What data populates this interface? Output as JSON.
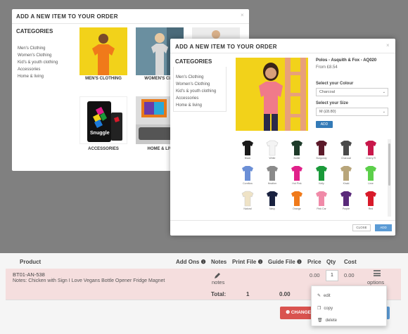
{
  "order": {
    "headers": {
      "product": "Product",
      "addons": "Add Ons ❶",
      "notes": "Notes",
      "print_file": "Print File ❶",
      "guide_file": "Guide File ❶",
      "price": "Price",
      "qty": "Qty",
      "cost": "Cost"
    },
    "row": {
      "sku": "BT01-AN-538",
      "notes_label": "Notes:",
      "notes_text": "Chicken with Sign I Love Vegans Bottle Opener Fridge Magnet",
      "notes_icon_label": "notes",
      "price": "0.00",
      "qty": "1",
      "cost": "0.00",
      "options_label": "options"
    },
    "total": {
      "label": "Total:",
      "qty": "1",
      "amount": "0.00"
    },
    "change_button": "CHANGE",
    "menu": {
      "edit": "edit",
      "copy": "copy",
      "delete": "delete"
    }
  },
  "modal1": {
    "title": "ADD A NEW ITEM TO YOUR ORDER",
    "close": "×",
    "categories_heading": "CATEGORIES",
    "categories": [
      "Men's Clothing",
      "Women's Clothing",
      "Kid's & youth clothing",
      "Accessories",
      "Home & living"
    ],
    "tiles": [
      {
        "label": "MEN'S CLOTHING"
      },
      {
        "label": "WOMEN'S CLO"
      },
      {
        "label": "ACCESSORIES"
      },
      {
        "label": "HOME & LIV"
      }
    ],
    "snuggle_text": "Snuggle"
  },
  "modal2": {
    "title": "ADD A NEW ITEM TO YOUR ORDER",
    "close": "×",
    "categories_heading": "CATEGORIES",
    "categories": [
      "Men's Clothing",
      "Women's Clothing",
      "Kid's & youth clothing",
      "Accessories",
      "Home & living"
    ],
    "product_title": "Polos - Asquith & Fox - AQ020",
    "product_price": "From £8.54",
    "colour_label": "Select your Colour",
    "colour_value": "Charcoal",
    "size_label": "Select your Size",
    "size_value": "M (£8.80)",
    "add_button": "ADD",
    "swatches": [
      {
        "name": "Black",
        "color": "#1a1a1a"
      },
      {
        "name": "White",
        "color": "#f4f4f4"
      },
      {
        "name": "Bottle",
        "color": "#1e3b2a"
      },
      {
        "name": "Burgundy",
        "color": "#5c1a2a"
      },
      {
        "name": "Charcoal",
        "color": "#4a4a4a"
      },
      {
        "name": "Cherry R",
        "color": "#c8174a"
      },
      {
        "name": "Cornflow",
        "color": "#6b8fd6"
      },
      {
        "name": "Heather",
        "color": "#8a8a8a"
      },
      {
        "name": "Hot Pink",
        "color": "#e0208a"
      },
      {
        "name": "Kelly",
        "color": "#1a9a3a"
      },
      {
        "name": "Khaki",
        "color": "#b8a57a"
      },
      {
        "name": "Lime",
        "color": "#5ccf4a"
      },
      {
        "name": "Natural",
        "color": "#efe3c6"
      },
      {
        "name": "Navy",
        "color": "#1a2240"
      },
      {
        "name": "Orange",
        "color": "#f07a1a"
      },
      {
        "name": "Pink Car",
        "color": "#f08aa8"
      },
      {
        "name": "Purple",
        "color": "#5a2a7a"
      },
      {
        "name": "Red",
        "color": "#d81a2a"
      },
      {
        "name": "",
        "color": "#1d3d8a"
      },
      {
        "name": "",
        "color": "#2a2a2a"
      },
      {
        "name": "",
        "color": "#dddddd"
      },
      {
        "name": "",
        "color": "#1a4a9a"
      },
      {
        "name": "",
        "color": "#333333"
      },
      {
        "name": "",
        "color": "#8a1a2a"
      }
    ],
    "close_button": "CLOSE",
    "add_footer_button": "ADD"
  }
}
